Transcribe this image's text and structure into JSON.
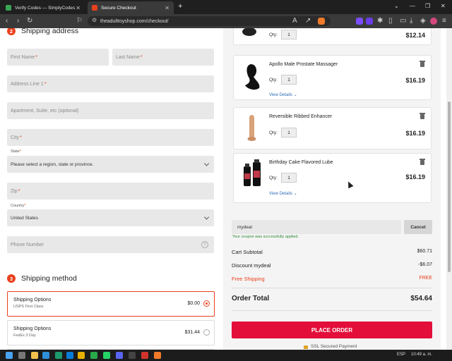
{
  "browser": {
    "tabs": [
      {
        "label": "Verify Codes — SimplyCodes",
        "active": false
      },
      {
        "label": "Secure Checkout",
        "active": true
      }
    ],
    "url": "theadulttoyshop.com/checkout/"
  },
  "shipping_address": {
    "step_number": "2",
    "heading": "Shipping address",
    "first_name_placeholder": "First Name",
    "last_name_placeholder": "Last Name",
    "address1_placeholder": "Address Line 1",
    "address2_placeholder": "Apartment, Suite, etc (optional)",
    "city_placeholder": "City",
    "state_label": "State",
    "state_value": "Please select a region, state or province.",
    "zip_placeholder": "Zip",
    "country_label": "Country",
    "country_value": "United States",
    "phone_placeholder": "Phone Number",
    "help_glyph": "?",
    "required_mark": "*"
  },
  "shipping_method": {
    "step_number": "3",
    "heading": "Shipping method",
    "options": [
      {
        "name": "Shipping Options",
        "carrier": "USPS First Class",
        "price": "$0.00",
        "selected": true
      },
      {
        "name": "Shipping Options",
        "carrier": "FedEx 3 Day",
        "price": "$31.44",
        "selected": false
      }
    ]
  },
  "cart": {
    "qty_label": "Qty:",
    "view_details": "View Details ⌄",
    "items": [
      {
        "name": "",
        "qty": "1",
        "price": "$12.14"
      },
      {
        "name": "Apollo Male Prostate Massager",
        "qty": "1",
        "price": "$16.19"
      },
      {
        "name": "Reversible Ribbed Enhancer",
        "qty": "1",
        "price": "$16.19"
      },
      {
        "name": "Birthday Cake Flavored Lube",
        "qty": "1",
        "price": "$16.19"
      }
    ]
  },
  "coupon": {
    "code": "mydeal",
    "cancel_label": "Cancel",
    "message": "Your coupon was successfully applied."
  },
  "summary": {
    "subtotal_label": "Cart Subtotal",
    "subtotal_value": "$60.71",
    "discount_label": "Discount mydeal",
    "discount_value": "-$6.07",
    "shipping_label": "Free Shipping",
    "shipping_value": "FREE",
    "total_label": "Order Total",
    "total_value": "$54.64",
    "place_order_label": "PLACE ORDER",
    "ssl_label": "SSL Secured Payment"
  },
  "taskbar": {
    "language": "ESP",
    "clock": "10:49 a. m."
  },
  "colors": {
    "accent": "#e8401c",
    "place_order": "#e30e3a",
    "success": "#2e8b3a"
  }
}
